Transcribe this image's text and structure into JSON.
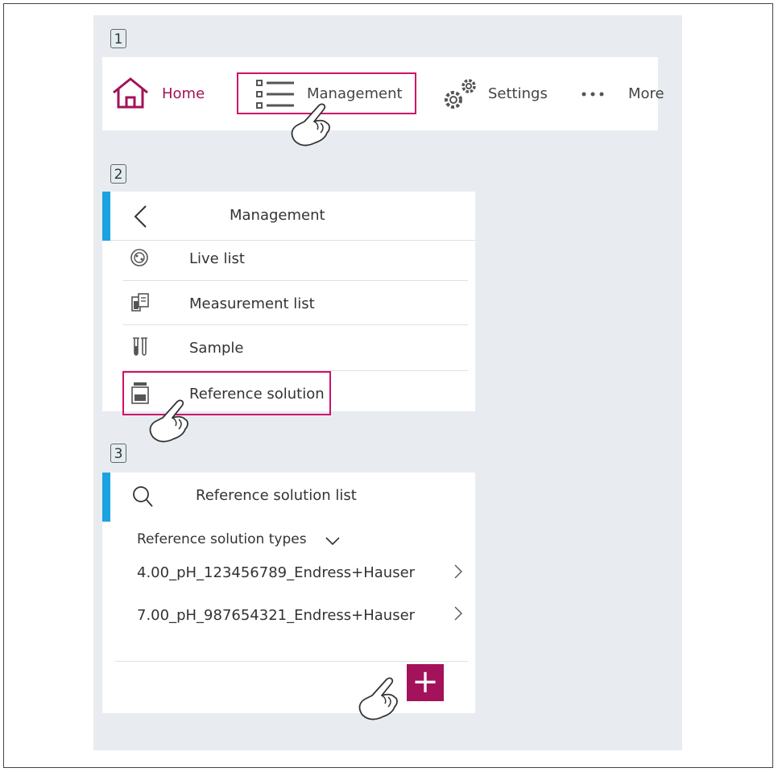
{
  "steps": [
    "1",
    "2",
    "3"
  ],
  "nav": {
    "home": "Home",
    "management": "Management",
    "settings": "Settings",
    "more": "More"
  },
  "management_menu": {
    "title": "Management",
    "items": [
      {
        "label": "Live list",
        "icon": "live-list-icon"
      },
      {
        "label": "Measurement list",
        "icon": "measurement-list-icon"
      },
      {
        "label": "Sample",
        "icon": "sample-tubes-icon"
      },
      {
        "label": "Reference solution",
        "icon": "reference-bottle-icon"
      }
    ]
  },
  "reference_list": {
    "title": "Reference solution list",
    "filter_label": "Reference solution types",
    "items": [
      "4.00_pH_123456789_Endress+Hauser",
      "7.00_pH_987654321_Endress+Hauser"
    ],
    "add_symbol": "+"
  },
  "colors": {
    "accent": "#a3125a",
    "highlight": "#d0106a",
    "bar": "#1aa3e0",
    "background": "#e8ecf0"
  }
}
